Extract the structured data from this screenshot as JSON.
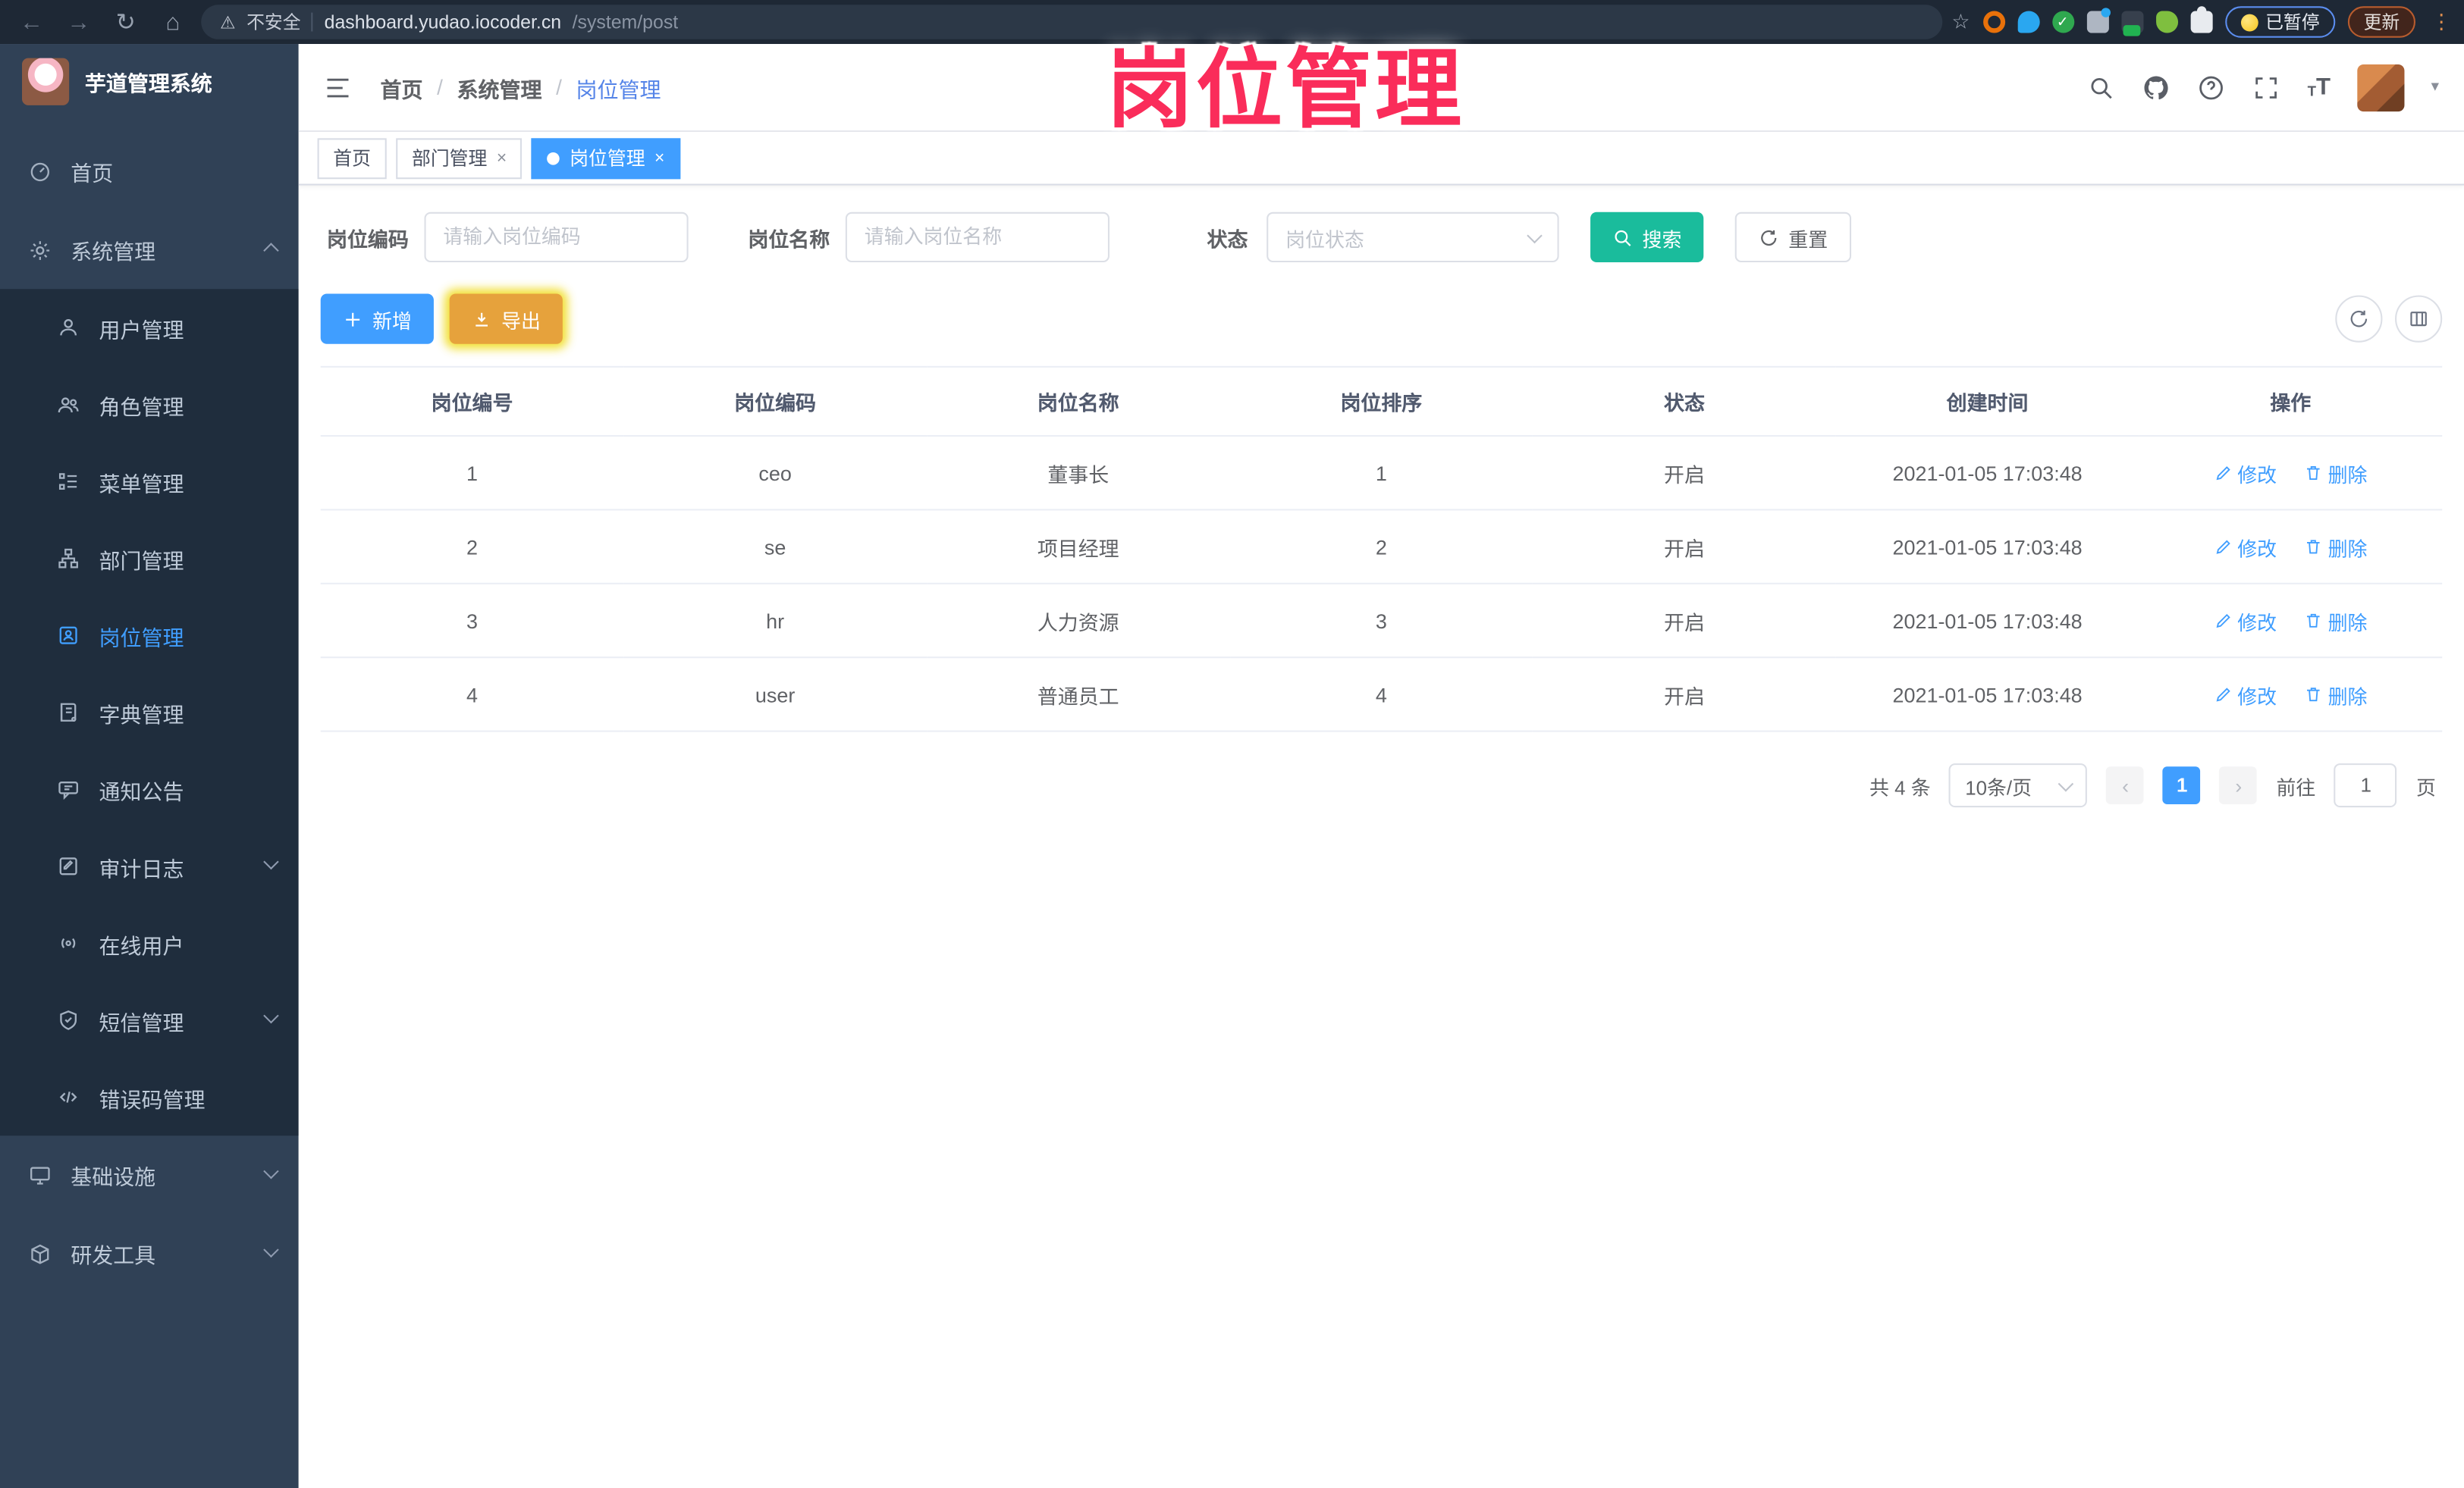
{
  "annotation": {
    "title": "岗位管理"
  },
  "browser": {
    "back": "←",
    "forward": "→",
    "reload": "↻",
    "home": "⌂",
    "security_label": "不安全",
    "url_host": "dashboard.yudao.iocoder.cn",
    "url_path": "/system/post",
    "star": "☆",
    "paused_label": "已暂停",
    "update_label": "更新",
    "menu_dots": "⋮",
    "warning_glyph": "⚠"
  },
  "app": {
    "title": "芋道管理系统"
  },
  "sidebar": {
    "items": [
      {
        "label": "首页",
        "icon": "dashboard-icon"
      },
      {
        "label": "系统管理",
        "icon": "gear-icon",
        "state": "expanded"
      },
      {
        "label": "基础设施",
        "icon": "infrastructure-icon",
        "state": "collapsed"
      },
      {
        "label": "研发工具",
        "icon": "devtools-icon",
        "state": "collapsed"
      }
    ],
    "system_children": [
      {
        "label": "用户管理",
        "icon": "user-icon"
      },
      {
        "label": "角色管理",
        "icon": "users-icon"
      },
      {
        "label": "菜单管理",
        "icon": "menu-list-icon"
      },
      {
        "label": "部门管理",
        "icon": "org-tree-icon"
      },
      {
        "label": "岗位管理",
        "icon": "post-icon",
        "active": true
      },
      {
        "label": "字典管理",
        "icon": "dictionary-icon"
      },
      {
        "label": "通知公告",
        "icon": "announcement-icon"
      },
      {
        "label": "审计日志",
        "icon": "audit-log-icon",
        "state": "collapsed"
      },
      {
        "label": "在线用户",
        "icon": "online-user-icon"
      },
      {
        "label": "短信管理",
        "icon": "sms-icon",
        "state": "collapsed"
      },
      {
        "label": "错误码管理",
        "icon": "error-code-icon"
      }
    ]
  },
  "header": {
    "breadcrumb": [
      "首页",
      "系统管理",
      "岗位管理"
    ],
    "separator": "/"
  },
  "tabs": [
    {
      "label": "首页"
    },
    {
      "label": "部门管理",
      "closable": true
    },
    {
      "label": "岗位管理",
      "closable": true,
      "active": true
    }
  ],
  "filters": {
    "code_label": "岗位编码",
    "code_placeholder": "请输入岗位编码",
    "name_label": "岗位名称",
    "name_placeholder": "请输入岗位名称",
    "status_label": "状态",
    "status_placeholder": "岗位状态",
    "search_label": "搜索",
    "reset_label": "重置"
  },
  "toolbar": {
    "add_label": "新增",
    "export_label": "导出"
  },
  "table": {
    "headers": [
      "岗位编号",
      "岗位编码",
      "岗位名称",
      "岗位排序",
      "状态",
      "创建时间",
      "操作"
    ],
    "edit_label": "修改",
    "delete_label": "删除",
    "rows": [
      {
        "id": "1",
        "code": "ceo",
        "name": "董事长",
        "sort": "1",
        "status": "开启",
        "created": "2021-01-05 17:03:48"
      },
      {
        "id": "2",
        "code": "se",
        "name": "项目经理",
        "sort": "2",
        "status": "开启",
        "created": "2021-01-05 17:03:48"
      },
      {
        "id": "3",
        "code": "hr",
        "name": "人力资源",
        "sort": "3",
        "status": "开启",
        "created": "2021-01-05 17:03:48"
      },
      {
        "id": "4",
        "code": "user",
        "name": "普通员工",
        "sort": "4",
        "status": "开启",
        "created": "2021-01-05 17:03:48"
      }
    ]
  },
  "pagination": {
    "total": "共 4 条",
    "page_size": "10条/页",
    "page": "1",
    "prev": "‹",
    "next": "›",
    "goto_label": "前往",
    "goto_value": "1",
    "unit_label": "页"
  },
  "colors": {
    "primary": "#409EFF",
    "success": "#1ABC9C",
    "warning": "#E6A23C",
    "annotation": "#FA2C5A",
    "sidebar_bg": "#304156",
    "submenu_bg": "#1F2D3D"
  }
}
